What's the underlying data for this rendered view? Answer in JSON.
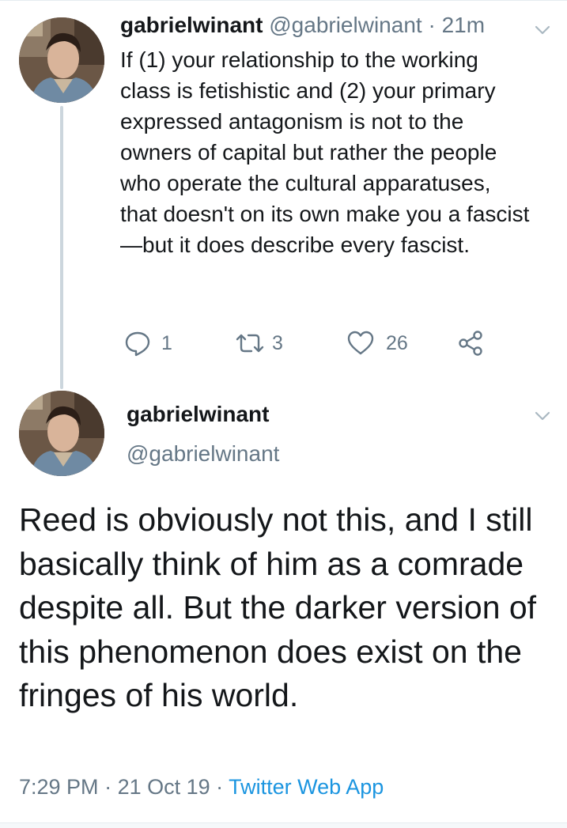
{
  "tweet1": {
    "display_name": "gabrielwinant",
    "handle": "@gabrielwinant",
    "separator": " · ",
    "time_ago": "21m",
    "text": "If (1) your relationship to the working class is fetishistic and (2) your primary expressed antagonism is not to the owners of capital but rather the people who operate the cultural apparatuses, that doesn't on its own make you a fascist—but it does describe every fascist.",
    "actions": {
      "reply_count": "1",
      "retweet_count": "3",
      "like_count": "26"
    }
  },
  "tweet2": {
    "display_name": "gabrielwinant",
    "handle": "@gabrielwinant",
    "text": "Reed is obviously not this, and I still basically think of him as a comrade despite all. But the darker version of this phenomenon does exist on the fringes of his world.",
    "time": "7:29 PM",
    "separator": " · ",
    "date": "21 Oct 19",
    "source": "Twitter Web App"
  },
  "colors": {
    "text_primary": "#14171a",
    "text_secondary": "#657786",
    "link": "#1b95e0",
    "thread_line": "#ccd6dd"
  },
  "icons": [
    "reply-icon",
    "retweet-icon",
    "like-icon",
    "share-icon",
    "chevron-down-icon"
  ]
}
